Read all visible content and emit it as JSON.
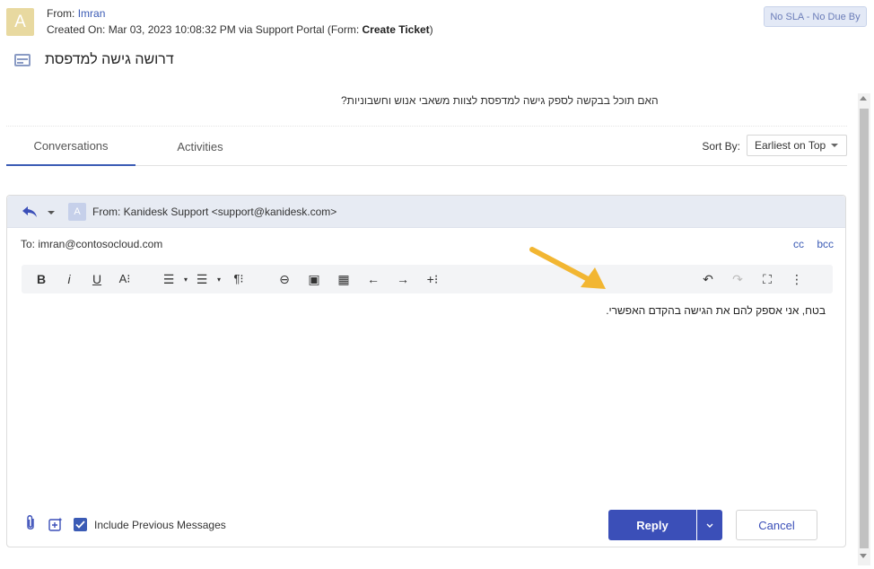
{
  "ticket": {
    "avatar_letter": "A",
    "from_label": "From:",
    "from_name": "Imran",
    "created_prefix": "Created On: Mar 03, 2023 10:08:32 PM via Support Portal (Form:",
    "form_name": "Create Ticket",
    "created_suffix": ")",
    "sla_badge": "No SLA - No Due By",
    "subject": "דרושה גישה למדפסת",
    "question": "האם תוכל בבקשה לספק גישה למדפסת לצוות משאבי אנוש וחשבוניות?"
  },
  "tabs": [
    {
      "label": "Conversations",
      "active": true
    },
    {
      "label": "Activities",
      "active": false
    }
  ],
  "sort": {
    "label": "Sort By:",
    "value": "Earliest on Top"
  },
  "reply": {
    "avatar_letter": "A",
    "from_line": "From: Kanidesk Support <support@kanidesk.com>",
    "to_line": "To: imran@contosocloud.com",
    "cc": "cc",
    "bcc": "bcc",
    "body": "בטח, אני אספק להם את הגישה בהקדם האפשרי.",
    "include_previous_label": "Include Previous Messages",
    "include_previous_checked": true,
    "reply_button": "Reply",
    "cancel_button": "Cancel"
  },
  "toolbar": {
    "bold": "B",
    "italic": "i",
    "underline": "U",
    "font_size": "A⁝",
    "ordered_list": "☰",
    "unordered_list": "☰",
    "paragraph": "¶⁝",
    "link": "⊖",
    "image": "▣",
    "table": "▦",
    "outdent": "←",
    "indent": "→",
    "more_insert": "+⁝",
    "undo": "↶",
    "redo": "↷",
    "fullscreen": "⛶",
    "more": "⋮"
  },
  "colors": {
    "accent": "#3b4fb8",
    "link": "#3b5bb5",
    "annotation_arrow": "#f2b632"
  }
}
